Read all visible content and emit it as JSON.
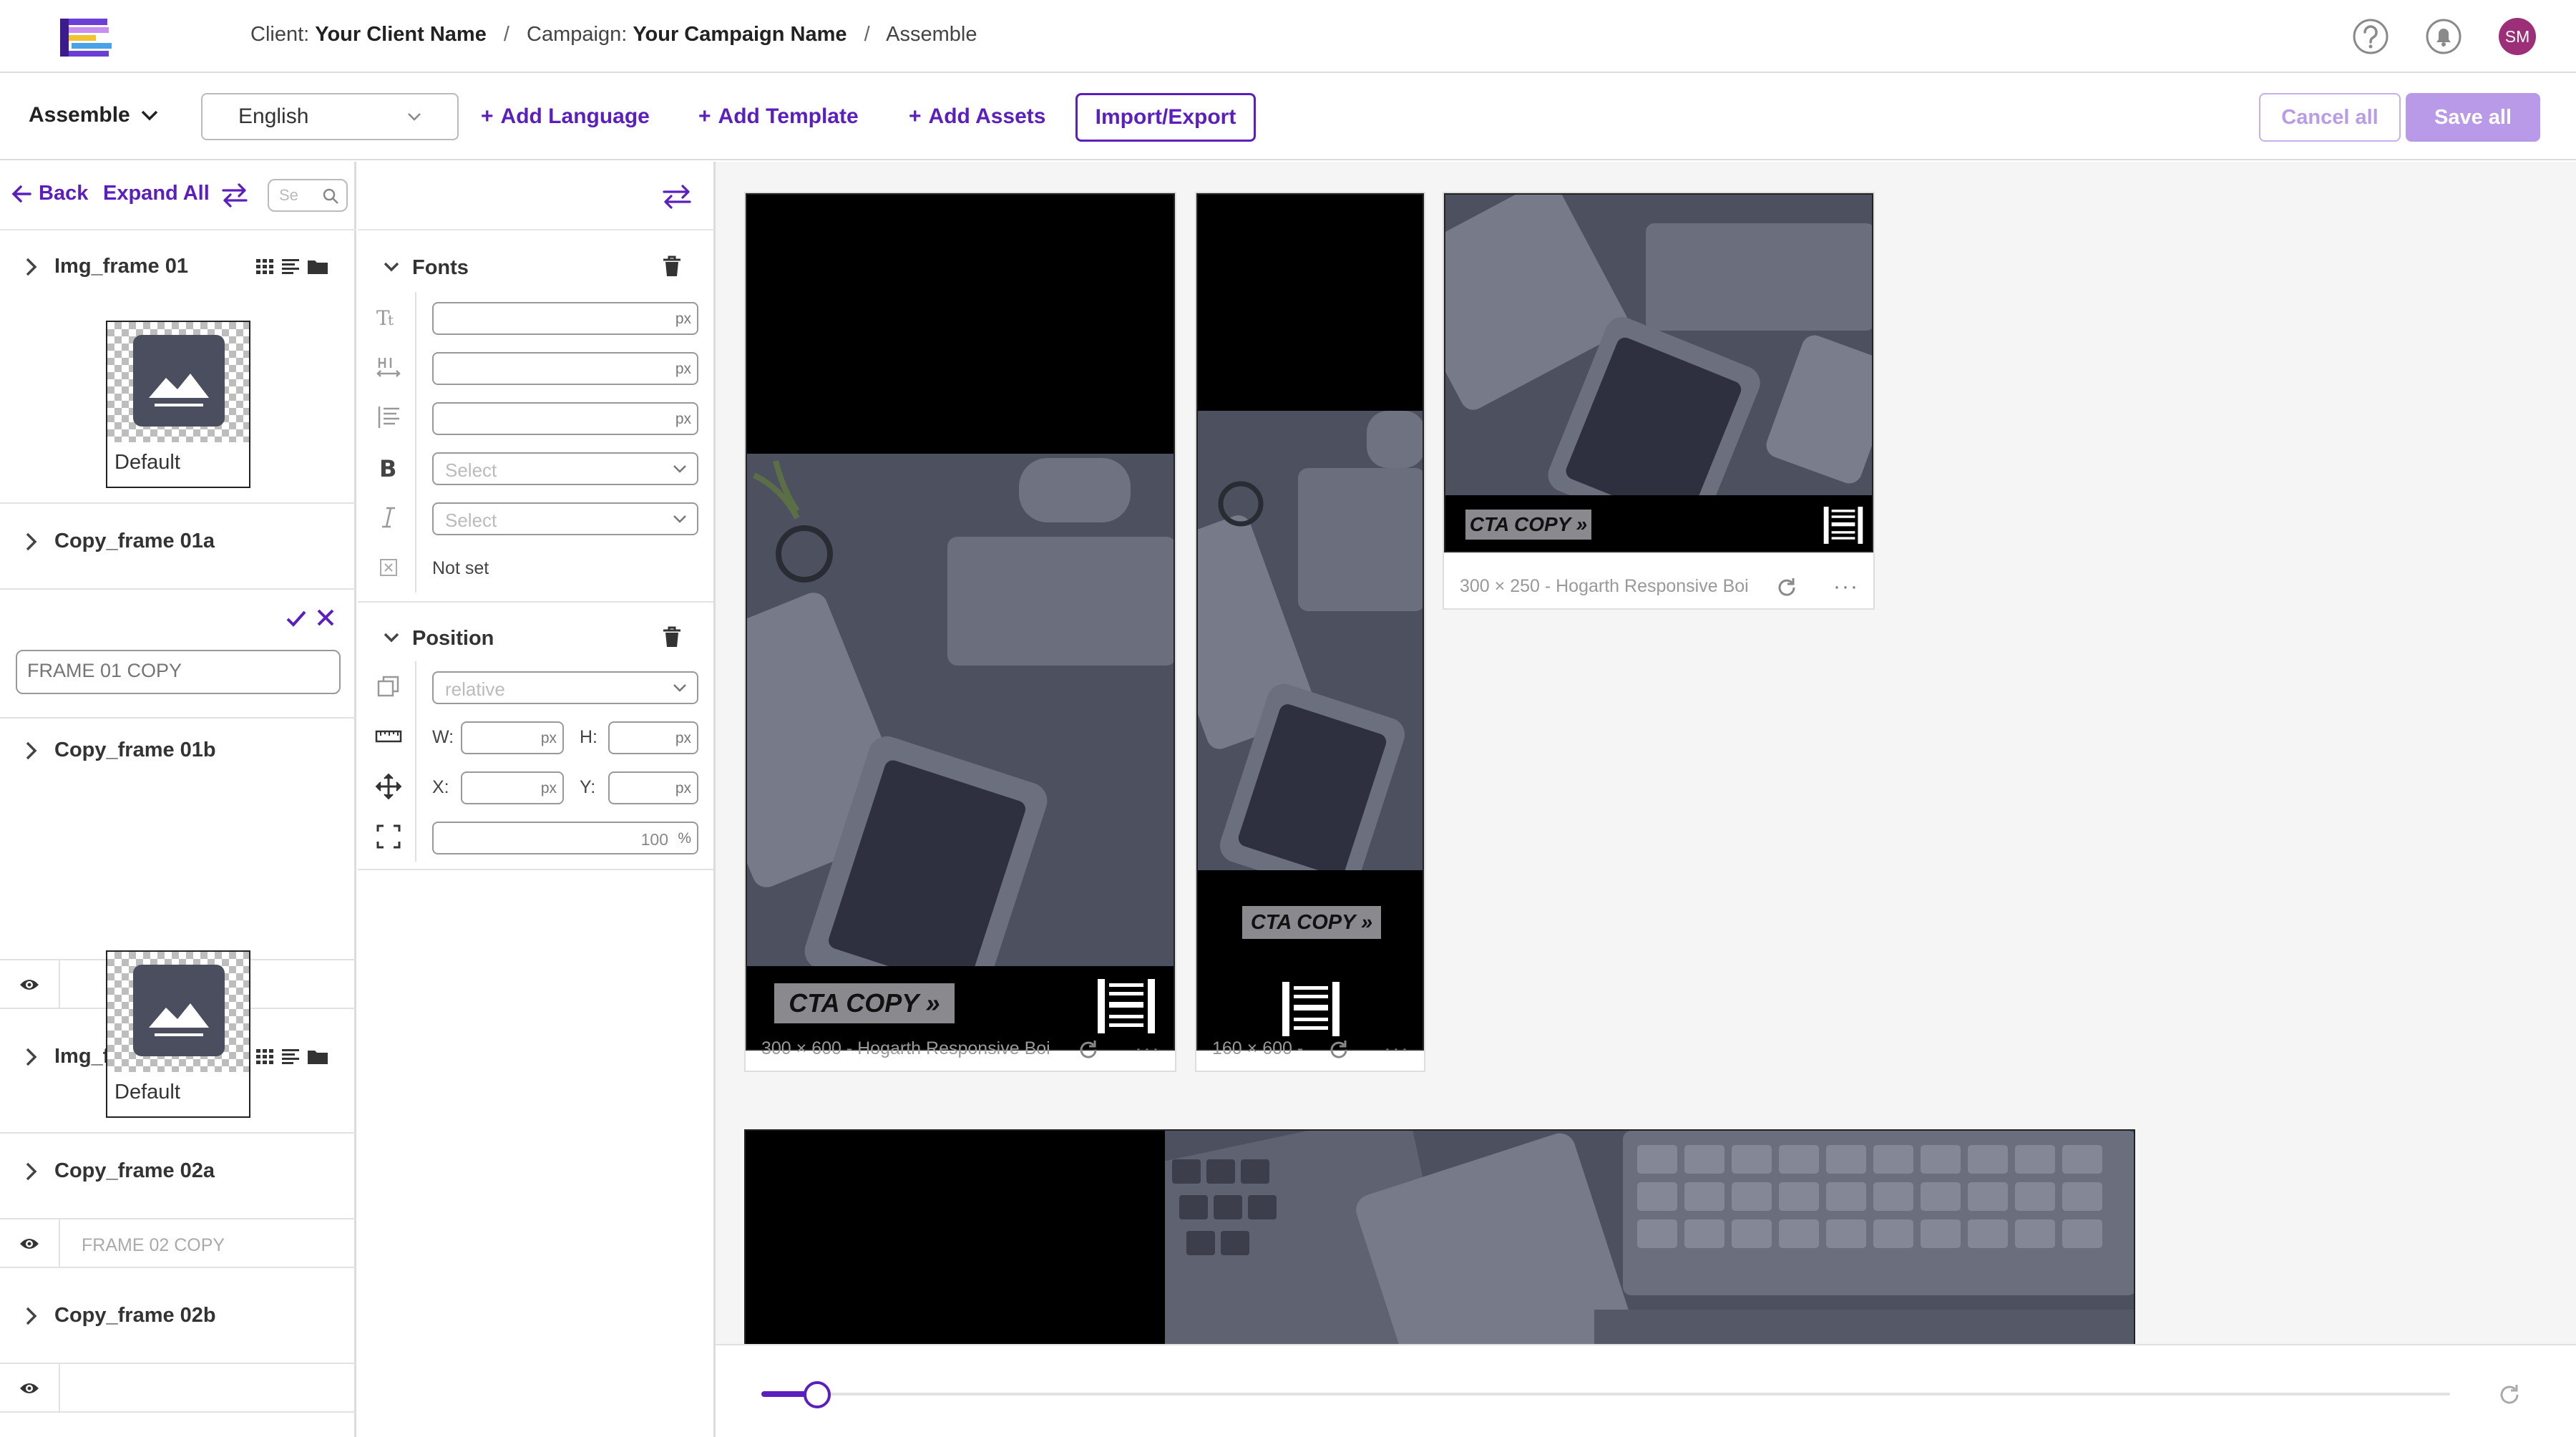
{
  "header": {
    "client_label": "Client:",
    "client_name": "Your Client Name",
    "campaign_label": "Campaign:",
    "campaign_name": "Your Campaign Name",
    "page": "Assemble",
    "sep": "/",
    "avatar_initials": "SM"
  },
  "toolbar": {
    "mode": "Assemble",
    "language": "English",
    "add_language": "Add Language",
    "add_template": "Add Template",
    "add_assets": "Add Assets",
    "import_export": "Import/Export",
    "cancel_all": "Cancel all",
    "save_all": "Save all"
  },
  "left_panel": {
    "back": "Back",
    "expand_all": "Expand All",
    "search_placeholder": "Se",
    "layers": [
      {
        "name": "Img_frame 01",
        "thumb_label": "Default"
      },
      {
        "name": "Copy_frame 01a",
        "editor_placeholder": "FRAME 01 COPY"
      },
      {
        "name": "Copy_frame 01b",
        "preview": ""
      },
      {
        "name": "Img_frame 02",
        "thumb_label": "Default"
      },
      {
        "name": "Copy_frame 02a",
        "preview": "FRAME 02 COPY"
      },
      {
        "name": "Copy_frame 02b",
        "preview": ""
      }
    ]
  },
  "properties": {
    "fonts_title": "Fonts",
    "unit_px": "px",
    "unit_pct": "%",
    "weight_placeholder": "Select",
    "style_placeholder": "Select",
    "color_value": "Not set",
    "position_title": "Position",
    "position_type": "relative",
    "w_label": "W:",
    "h_label": "H:",
    "x_label": "X:",
    "y_label": "Y:",
    "scale_value": "100"
  },
  "canvas": {
    "cards": [
      {
        "caption": "300 × 600 - Hogarth Responsive Boi",
        "cta": "CTA COPY »"
      },
      {
        "caption": "160 × 600 -",
        "cta": "CTA COPY »"
      },
      {
        "caption": "300 × 250 - Hogarth Responsive Boi",
        "cta": "CTA COPY »"
      }
    ]
  },
  "zoom": {
    "level": 0.033
  },
  "colors": {
    "accent": "#5b1fbf",
    "accent_light": "#b99ae8",
    "avatar": "#9c2f77",
    "image_overlay": "#4e5160"
  },
  "icons": [
    "logo",
    "help-icon",
    "bell-icon",
    "chevron-down-icon",
    "plus-icon",
    "back-arrow-icon",
    "swap-icon",
    "search-icon",
    "chevron-right-icon",
    "grid-icon",
    "text-lines-icon",
    "folder-icon",
    "check-icon",
    "close-icon",
    "eye-icon",
    "trash-icon",
    "font-size-icon",
    "letter-spacing-icon",
    "line-height-icon",
    "bold-icon",
    "italic-icon",
    "color-icon",
    "layers-icon",
    "ruler-icon",
    "move-icon",
    "fullscreen-icon",
    "refresh-icon",
    "more-icon"
  ]
}
